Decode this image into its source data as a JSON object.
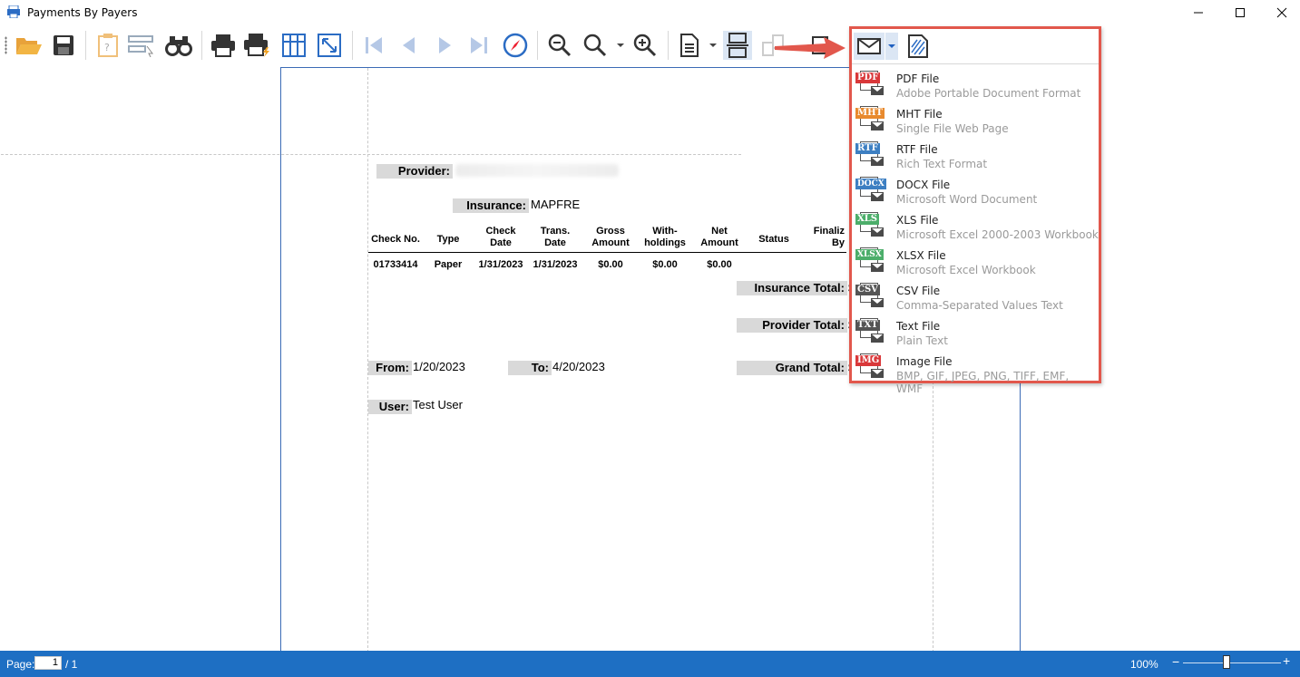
{
  "window": {
    "title": "Payments By Payers",
    "minimize_glyph": "—",
    "maximize_glyph": "☐",
    "close_glyph": "✕"
  },
  "toolbar": {
    "buttons": [
      "open-icon",
      "save-icon",
      "parameters-icon",
      "editing-fields-icon",
      "find-icon",
      "print-icon",
      "quick-print-icon",
      "page-setup-icon",
      "scale-icon",
      "first-page-icon",
      "previous-page-icon",
      "next-page-icon",
      "last-page-icon",
      "navigation-icon",
      "zoom-out-icon",
      "zoom-icon",
      "zoom-in-icon",
      "view-options-icon",
      "multipage-icon",
      "background-icon",
      "export-icon",
      "send-icon",
      "watermark-icon"
    ]
  },
  "report": {
    "provider_label": "Provider:",
    "insurance_label": "Insurance:",
    "insurance_value": "MAPFRE",
    "columns": [
      "Check No.",
      "Type",
      "Check\nDate",
      "Trans.\nDate",
      "Gross\nAmount",
      "With-\nholdings",
      "Net\nAmount",
      "Status",
      "Finaliz\nBy"
    ],
    "rows": [
      {
        "check_no": "01733414",
        "type": "Paper",
        "check_date": "1/31/2023",
        "trans_date": "1/31/2023",
        "gross": "$0.00",
        "withholdings": "$0.00",
        "net": "$0.00"
      }
    ],
    "insurance_total_label": "Insurance Total:",
    "provider_total_label": "Provider Total:",
    "grand_total_label": "Grand Total:",
    "total_prefix": "$",
    "from_label": "From:",
    "from_value": "1/20/2023",
    "to_label": "To:",
    "to_value": "4/20/2023",
    "user_label": "User:",
    "user_value": "Test User"
  },
  "export_menu": {
    "items": [
      {
        "badge": "PDF",
        "color": "#d9383a",
        "name": "PDF File",
        "desc": "Adobe Portable Document Format"
      },
      {
        "badge": "MHT",
        "color": "#e88a2e",
        "name": "MHT File",
        "desc": "Single File Web Page"
      },
      {
        "badge": "RTF",
        "color": "#3d7fc2",
        "name": "RTF File",
        "desc": "Rich Text Format"
      },
      {
        "badge": "DOCX",
        "color": "#3d7fc2",
        "name": "DOCX File",
        "desc": "Microsoft Word Document"
      },
      {
        "badge": "XLS",
        "color": "#4cae6a",
        "name": "XLS File",
        "desc": "Microsoft Excel 2000-2003 Workbook"
      },
      {
        "badge": "XLSX",
        "color": "#4cae6a",
        "name": "XLSX File",
        "desc": "Microsoft Excel Workbook"
      },
      {
        "badge": "CSV",
        "color": "#555555",
        "name": "CSV File",
        "desc": "Comma-Separated Values Text"
      },
      {
        "badge": "TXT",
        "color": "#555555",
        "name": "Text File",
        "desc": "Plain Text"
      },
      {
        "badge": "IMG",
        "color": "#d9383a",
        "name": "Image File",
        "desc": "BMP, GIF, JPEG, PNG, TIFF, EMF, WMF"
      }
    ]
  },
  "statusbar": {
    "page_label": "Page:",
    "page_value": "1",
    "page_total": "/ 1",
    "zoom": "100%",
    "zoom_minus": "−",
    "zoom_plus": "+"
  },
  "colors": {
    "accent": "#1e6fc3",
    "highlight": "#e2574c",
    "toolbar_active": "#dbe6f4"
  }
}
